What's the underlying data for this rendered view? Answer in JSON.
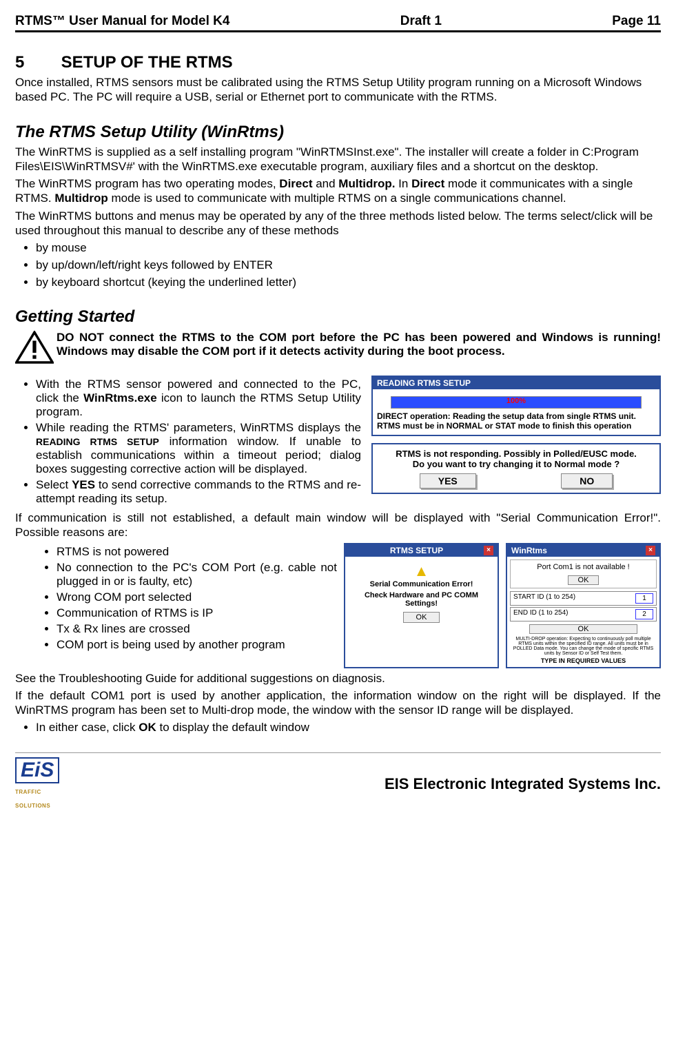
{
  "header": {
    "left": "RTMS™  User Manual for Model K4",
    "center": "Draft 1",
    "right": "Page 11"
  },
  "sec5": {
    "num": "5",
    "title": "SETUP OF THE RTMS",
    "intro": "Once installed, RTMS sensors must be calibrated using the RTMS Setup Utility program running on a Microsoft Windows based PC.  The PC will require a USB, serial or Ethernet port to communicate with the RTMS."
  },
  "utility": {
    "title": "The RTMS Setup Utility (WinRtms)",
    "p1a": "The WinRTMS is supplied as a self installing program \"WinRTMSInst.exe\".  The installer will create a folder in C:Program Files\\EIS\\WinRTMSV#'  with the WinRTMS.exe executable program, auxiliary files and a shortcut on the desktop.",
    "p2_pre": "The WinRTMS program has two operating modes, ",
    "p2_b1": "Direct",
    "p2_mid1": " and ",
    "p2_b2": "Multidrop.",
    "p2_mid2": "  In ",
    "p2_b3": "Direct",
    "p2_mid3": " mode it communicates with a single RTMS.  ",
    "p2_b4": "Multidrop",
    "p2_tail": " mode is used to communicate with multiple RTMS on a single communications channel.",
    "p3": "The WinRTMS buttons and menus may be operated by any of the three methods listed below. The terms select/click will be used throughout this manual to describe any of these methods",
    "bullets": [
      "by mouse",
      "by up/down/left/right keys followed by ENTER",
      "by keyboard shortcut (keying the underlined letter)"
    ]
  },
  "getting": {
    "title": "Getting Started",
    "warn": "DO NOT connect the RTMS to the COM port before the PC has been powered and Windows is running!  Windows may disable the COM port if it detects activity during the boot process.",
    "b1_pre": "With the RTMS sensor powered and connected to the PC, click the ",
    "b1_bold": "WinRtms.exe",
    "b1_post": " icon to launch the RTMS Setup Utility program.",
    "b2_pre": "While reading the RTMS' parameters, WinRTMS displays the ",
    "b2_sc": "READING RTMS SETUP",
    "b2_post": " information window.  If unable to establish communications within a timeout period; dialog boxes suggesting corrective action will be displayed.",
    "b3_pre": "Select ",
    "b3_bold": "YES",
    "b3_post": " to send corrective commands to the RTMS and re-attempt reading its setup.",
    "p_after": "If communication is still not established, a default main window will be displayed with \"Serial Communication Error!\".   Possible reasons are:",
    "reasons": [
      "RTMS is not powered",
      "No connection to the PC's COM Port (e.g. cable not plugged in or is faulty,  etc)",
      "Wrong COM port selected",
      "Communication of RTMS is IP",
      "Tx & Rx lines are crossed",
      "COM port is being used by another program"
    ],
    "p_see": "See the Troubleshooting Guide for additional suggestions on diagnosis.",
    "p_default": "If the default COM1 port is used by another application, the information window on the right will be displayed.  If the WinRTMS program has been set to Multi-drop mode, the window with the sensor ID range will be displayed.",
    "b_ok_pre": "In either case, click ",
    "b_ok_bold": "OK",
    "b_ok_post": " to display the default window"
  },
  "dialog1": {
    "title": "READING RTMS SETUP",
    "pct": "100%",
    "line1": "DIRECT operation: Reading the setup data from single RTMS unit.",
    "line2": "RTMS must be in NORMAL or STAT mode to finish this operation",
    "q1": "RTMS is not responding. Possibly in Polled/EUSC mode.",
    "q2": "Do you want to try changing it to Normal mode ?",
    "yes": "YES",
    "no": "NO"
  },
  "dialog2": {
    "title": "RTMS SETUP",
    "err": "Serial Communication Error!",
    "check": "Check Hardware and PC COMM Settings!",
    "ok": "OK"
  },
  "dialog3": {
    "title": "WinRtms",
    "msg": "Port Com1 is not available !",
    "ok": "OK",
    "start": "START ID (1 to 254)",
    "startval": "1",
    "end": "END ID (1 to 254)",
    "endval": "2",
    "ok2": "OK",
    "note": "MULTI-DROP operation: Expecting to continuously poll multiple RTMS units within the specified ID range. All units must be in POLLED Data mode. You can change the mode of specific RTMS units by Sensor ID or Self Test them.",
    "type": "TYPE IN REQUIRED VALUES"
  },
  "footer": {
    "logo_main": "EiS",
    "logo_sub": "TRAFFIC SOLUTIONS",
    "company": "EIS Electronic Integrated Systems Inc."
  }
}
